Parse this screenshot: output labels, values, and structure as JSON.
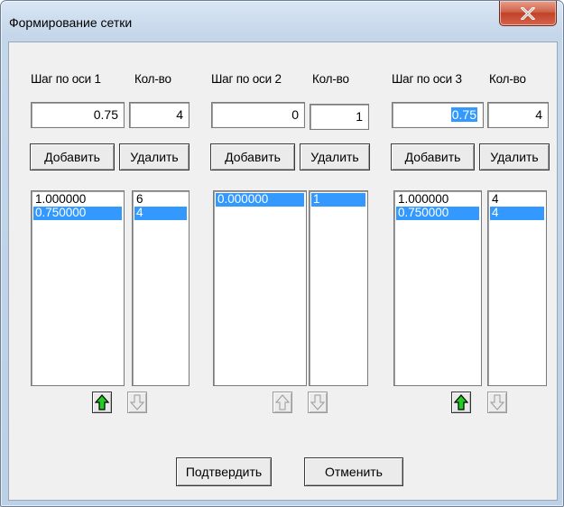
{
  "window": {
    "title": "Формирование сетки"
  },
  "axes": [
    {
      "step_label": "Шаг по оси 1",
      "count_label": "Кол-во",
      "step_value": "0.75",
      "count_value": "4",
      "step_selected": false,
      "add_label": "Добавить",
      "remove_label": "Удалить",
      "steps": [
        "1.000000",
        "0.750000"
      ],
      "counts": [
        "6",
        "4"
      ],
      "steps_selected_index": 1,
      "counts_selected_index": 1,
      "up_enabled": true,
      "down_enabled": false
    },
    {
      "step_label": "Шаг по оси 2",
      "count_label": "Кол-во",
      "step_value": "0",
      "count_value": "1",
      "step_selected": false,
      "add_label": "Добавить",
      "remove_label": "Удалить",
      "steps": [
        "0.000000"
      ],
      "counts": [
        "1"
      ],
      "steps_selected_index": 0,
      "counts_selected_index": 0,
      "up_enabled": false,
      "down_enabled": false
    },
    {
      "step_label": "Шаг по оси 3",
      "count_label": "Кол-во",
      "step_value": "0.75",
      "count_value": "4",
      "step_selected": true,
      "add_label": "Добавить",
      "remove_label": "Удалить",
      "steps": [
        "1.000000",
        "0.750000"
      ],
      "counts": [
        "4",
        "4"
      ],
      "steps_selected_index": 1,
      "counts_selected_index": 1,
      "up_enabled": true,
      "down_enabled": false
    }
  ],
  "footer": {
    "confirm_label": "Подтвердить",
    "cancel_label": "Отменить"
  },
  "colors": {
    "selection": "#3399ff",
    "up_arrow_active": "#22cc22",
    "close_button": "#c7432b"
  },
  "icons": {
    "close": "close-icon",
    "up": "arrow-up-icon",
    "down": "arrow-down-icon"
  }
}
